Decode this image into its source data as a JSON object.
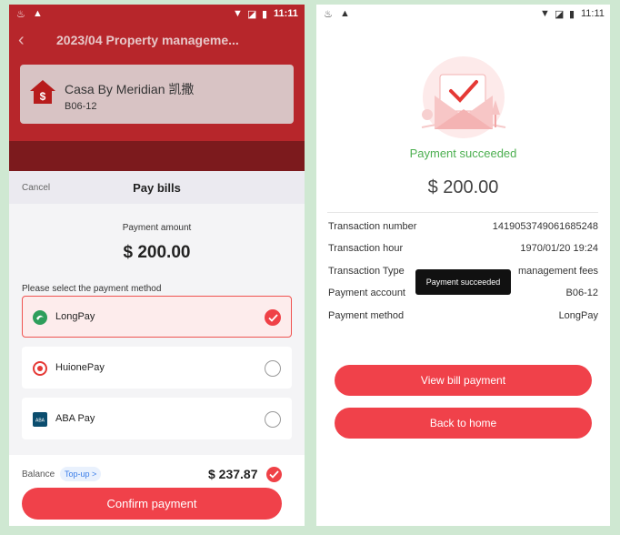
{
  "left": {
    "status": {
      "time": "11:11"
    },
    "header": {
      "title": "2023/04 Property manageme..."
    },
    "property": {
      "name": "Casa By Meridian 凯撒",
      "unit": "B06-12"
    },
    "sheet": {
      "cancel_label": "Cancel",
      "title": "Pay bills",
      "amount_label": "Payment amount",
      "amount_value": "$ 200.00",
      "select_label": "Please select the payment method",
      "methods": [
        {
          "label": "LongPay",
          "selected": true,
          "icon": "longpay-icon"
        },
        {
          "label": "HuionePay",
          "selected": false,
          "icon": "huionepay-icon"
        },
        {
          "label": "ABA Pay",
          "selected": false,
          "icon": "aba-pay-icon"
        }
      ],
      "balance_label": "Balance",
      "topup_label": "Top-up >",
      "balance_value": "$ 237.87",
      "confirm_label": "Confirm payment"
    }
  },
  "right": {
    "status": {
      "time": "11:11"
    },
    "success_text": "Payment succeeded",
    "amount": "$ 200.00",
    "details": [
      {
        "label": "Transaction number",
        "value": "1419053749061685248"
      },
      {
        "label": "Transaction hour",
        "value": "1970/01/20 19:24"
      },
      {
        "label": "Transaction Type",
        "value": "management fees"
      },
      {
        "label": "Payment account",
        "value": "B06-12"
      },
      {
        "label": "Payment method",
        "value": "LongPay"
      }
    ],
    "toast": "Payment succeeded",
    "view_bill_label": "View bill payment",
    "back_home_label": "Back to home"
  },
  "colors": {
    "accent": "#f0414a",
    "success": "#4caf50",
    "header_red": "#b7262b"
  }
}
